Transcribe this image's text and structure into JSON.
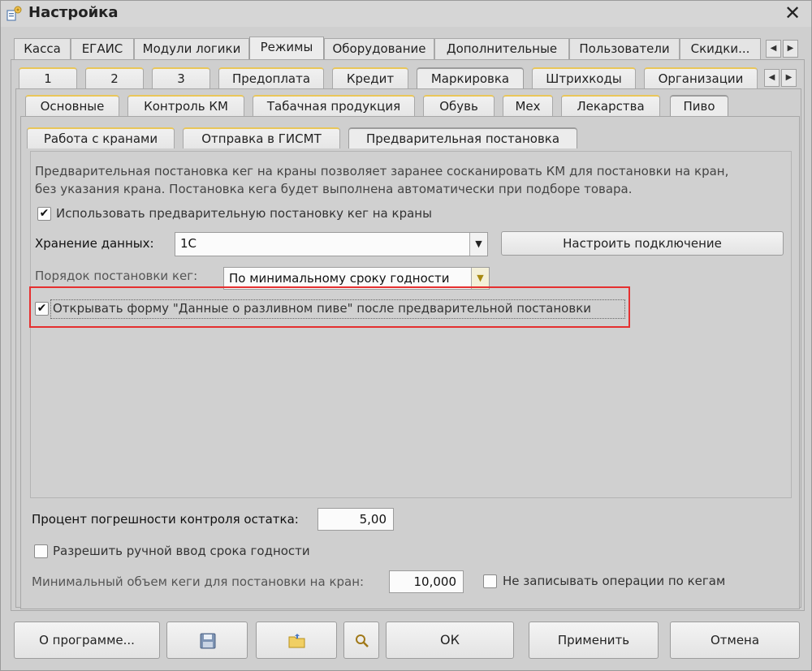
{
  "window": {
    "title": "Настройка",
    "close_symbol": "✕"
  },
  "tabs_level1": [
    "Касса",
    "ЕГАИС",
    "Модули логики",
    "Режимы",
    "Оборудование",
    "Дополнительные",
    "Пользователи",
    "Скидки..."
  ],
  "tabs_level1_selected": "Режимы",
  "tabs_level2": [
    "1",
    "2",
    "3",
    "Предоплата",
    "Кредит",
    "Маркировка",
    "Штрихкоды",
    "Организации"
  ],
  "tabs_level2_selected": "Маркировка",
  "tabs_level3": [
    "Основные",
    "Контроль КМ",
    "Табачная продукция",
    "Обувь",
    "Мех",
    "Лекарства",
    "Пиво"
  ],
  "tabs_level3_selected": "Пиво",
  "tabs_level4": [
    "Работа с кранами",
    "Отправка в ГИСМТ",
    "Предварительная постановка"
  ],
  "tabs_level4_selected": "Предварительная постановка",
  "scroll": {
    "left": "◀",
    "right": "▶"
  },
  "pre_setup": {
    "description_line1": "Предварительная постановка кег на краны позволяет заранее сосканировать КМ для постановки на кран,",
    "description_line2": "без указания крана. Постановка кега будет выполнена автоматически при подборе товара.",
    "use_pre_setup_label": "Использовать предварительную постановку кег на краны",
    "use_pre_setup_checked": true,
    "storage_label": "Хранение данных:",
    "storage_value": "1С",
    "configure_connection_label": "Настроить подключение",
    "order_label": "Порядок постановки кег:",
    "order_value": "По минимальному сроку годности",
    "open_form_label": "Открывать форму \"Данные о разливном пиве\" после предварительной постановки",
    "open_form_checked": true
  },
  "bottom_settings": {
    "tolerance_label": "Процент погрешности контроля остатка:",
    "tolerance_value": "5,00",
    "manual_expiry_label": "Разрешить ручной ввод срока годности",
    "manual_expiry_checked": false,
    "min_volume_label": "Минимальный объем кеги для постановки на кран:",
    "min_volume_value": "10,000",
    "no_log_ops_label": "Не записывать операции по кегам",
    "no_log_ops_checked": false
  },
  "footer_buttons": {
    "about": "О программе...",
    "ok": "ОК",
    "apply": "Применить",
    "cancel": "Отмена"
  },
  "colors": {
    "highlight": "#e53030",
    "tab_accent": "#e9c65a"
  },
  "icons": {
    "title": "settings-app-icon",
    "save": "floppy-disk-icon",
    "open": "folder-open-icon",
    "search": "magnifier-icon",
    "dropdown": "triangle-down-icon"
  }
}
